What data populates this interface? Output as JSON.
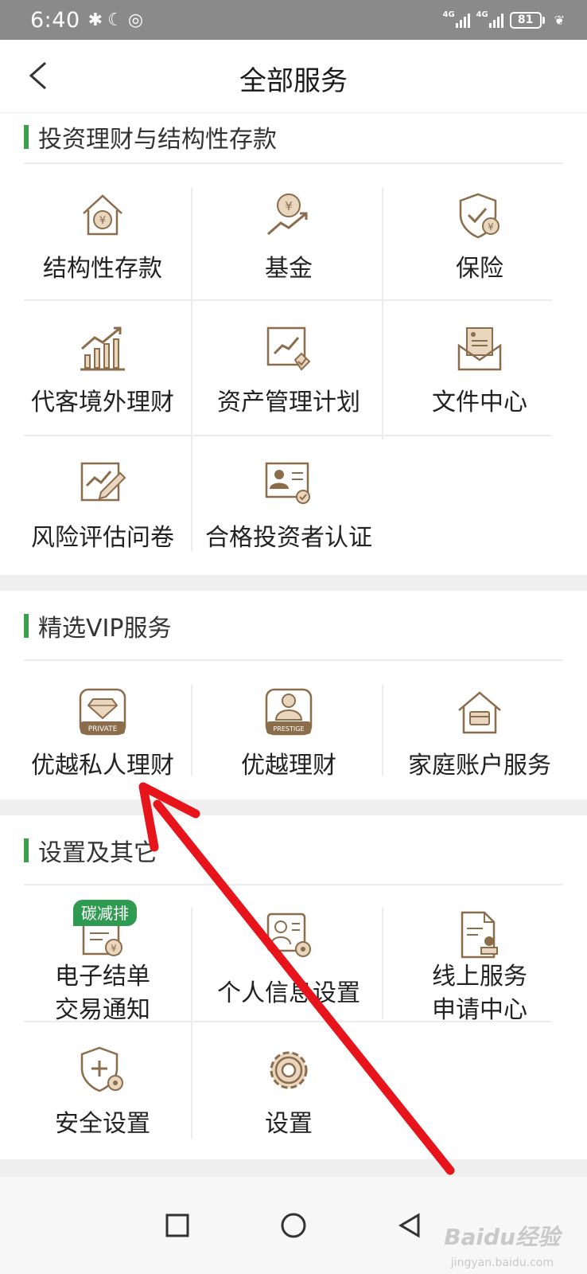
{
  "status_bar": {
    "time": "6:40",
    "network_1": "4G",
    "network_2": "4G",
    "battery": "81"
  },
  "header": {
    "title": "全部服务"
  },
  "sections": [
    {
      "title": "投资理财与结构性存款",
      "items": [
        {
          "label": "结构性存款",
          "icon": "house-yuan-icon"
        },
        {
          "label": "基金",
          "icon": "coin-growth-icon"
        },
        {
          "label": "保险",
          "icon": "shield-check-icon"
        },
        {
          "label": "代客境外理财",
          "icon": "bar-chart-growth-icon"
        },
        {
          "label": "资产管理计划",
          "icon": "chart-document-icon"
        },
        {
          "label": "文件中心",
          "icon": "envelope-document-icon"
        },
        {
          "label": "风险评估问卷",
          "icon": "chart-pen-icon"
        },
        {
          "label": "合格投资者认证",
          "icon": "id-card-certificate-icon"
        }
      ]
    },
    {
      "title": "精选VIP服务",
      "items": [
        {
          "label": "优越私人理财",
          "icon": "diamond-private-card-icon",
          "card_text": "PRIVATE"
        },
        {
          "label": "优越理财",
          "icon": "person-prestige-card-icon",
          "card_text": "PRESTIGE"
        },
        {
          "label": "家庭账户服务",
          "icon": "house-card-icon"
        }
      ]
    },
    {
      "title": "设置及其它",
      "items": [
        {
          "label": "电子结单\n交易通知",
          "line1": "电子结单",
          "line2": "交易通知",
          "icon": "statement-yuan-icon",
          "badge": "碳减排"
        },
        {
          "label": "个人信息设置",
          "icon": "profile-gear-icon"
        },
        {
          "label": "线上服务\n申请中心",
          "line1": "线上服务",
          "line2": "申请中心",
          "icon": "document-stamp-icon"
        },
        {
          "label": "安全设置",
          "icon": "shield-plus-gear-icon"
        },
        {
          "label": "设置",
          "icon": "gear-icon"
        }
      ]
    }
  ],
  "nav_bar": {
    "buttons": [
      "recent-apps",
      "home",
      "back"
    ]
  },
  "watermark": {
    "text": "Baidu经验",
    "sub": "jingyan.baidu.com"
  },
  "colors": {
    "accent_green": "#3ba04a",
    "icon_brown": "#8b6d4c",
    "icon_fill": "#e8d6bf",
    "annotation_red": "#e8141b"
  }
}
